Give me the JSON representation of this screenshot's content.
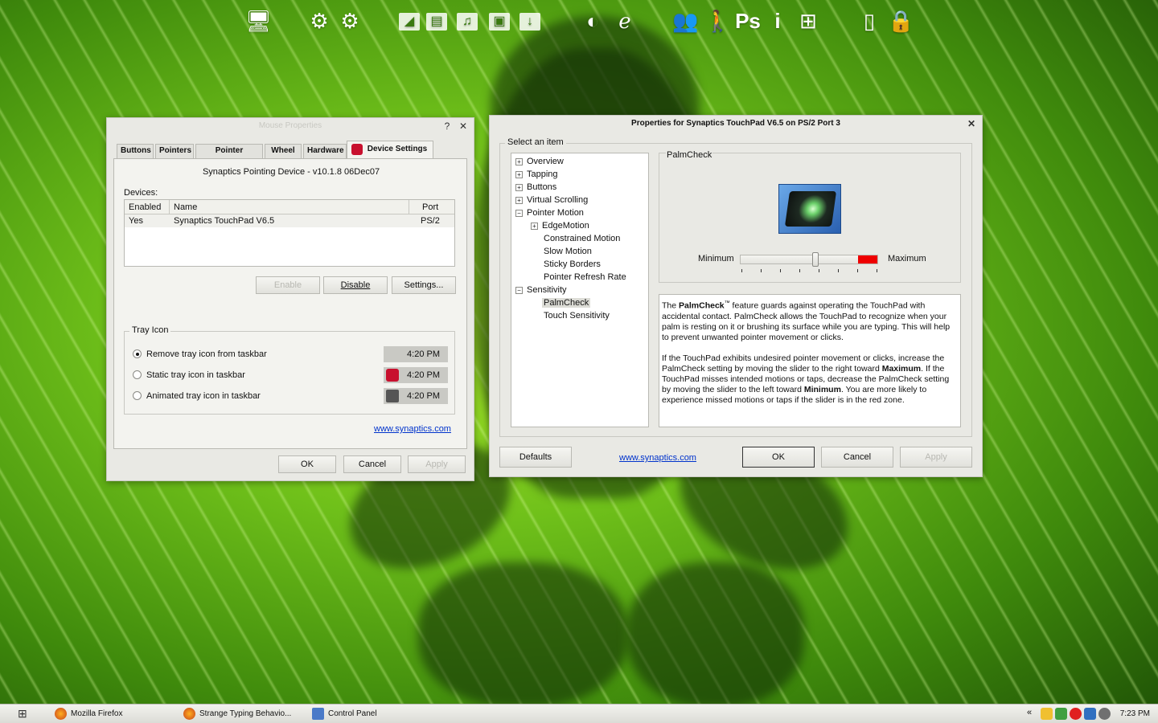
{
  "dock": {
    "icons": [
      "monitor-icon",
      "gear-icon",
      "gear-icon",
      "media-icon",
      "document-icon",
      "music-icon",
      "picture-icon",
      "download-icon",
      "firefox-icon",
      "internet-explorer-icon",
      "users-icon",
      "user-walk-icon",
      "photoshop-icon",
      "info-icon",
      "network-icon",
      "battery-icon",
      "lock-icon"
    ],
    "ps_label": "Ps",
    "info_label": "i"
  },
  "mouse_window": {
    "title": "Mouse Properties",
    "help": "?",
    "close": "✕",
    "tabs": [
      "Buttons",
      "Pointers",
      "Pointer Options",
      "Wheel",
      "Hardware",
      "Device Settings"
    ],
    "device_title": "Synaptics Pointing Device - v10.1.8 06Dec07",
    "devices_label": "Devices:",
    "columns": [
      "Enabled",
      "Name",
      "Port"
    ],
    "rows": [
      {
        "enabled": "Yes",
        "name": "Synaptics TouchPad V6.5",
        "port": "PS/2"
      }
    ],
    "enable_btn": "Enable",
    "disable_btn": "Disable",
    "settings_btn": "Settings...",
    "tray_group": "Tray Icon",
    "tray_options": [
      {
        "label": "Remove tray icon from taskbar",
        "time": "4:20 PM",
        "selected": true
      },
      {
        "label": "Static tray icon in taskbar",
        "time": "4:20 PM",
        "selected": false
      },
      {
        "label": "Animated tray icon in taskbar",
        "time": "4:20 PM",
        "selected": false
      }
    ],
    "link": "www.synaptics.com",
    "ok": "OK",
    "cancel": "Cancel",
    "apply": "Apply"
  },
  "synaptics_window": {
    "title": "Properties for Synaptics TouchPad V6.5 on PS/2 Port 3",
    "close": "✕",
    "select_label": "Select an item",
    "tree": [
      {
        "label": "Overview",
        "level": 0,
        "exp": "+"
      },
      {
        "label": "Tapping",
        "level": 0,
        "exp": "+"
      },
      {
        "label": "Buttons",
        "level": 0,
        "exp": "+"
      },
      {
        "label": "Virtual Scrolling",
        "level": 0,
        "exp": "+"
      },
      {
        "label": "Pointer Motion",
        "level": 0,
        "exp": "−"
      },
      {
        "label": "EdgeMotion",
        "level": 1,
        "exp": "+"
      },
      {
        "label": "Constrained Motion",
        "level": 1,
        "exp": ""
      },
      {
        "label": "Slow Motion",
        "level": 1,
        "exp": ""
      },
      {
        "label": "Sticky Borders",
        "level": 1,
        "exp": ""
      },
      {
        "label": "Pointer Refresh Rate",
        "level": 1,
        "exp": ""
      },
      {
        "label": "Sensitivity",
        "level": 0,
        "exp": "−"
      },
      {
        "label": "PalmCheck",
        "level": 1,
        "exp": "",
        "selected": true
      },
      {
        "label": "Touch Sensitivity",
        "level": 1,
        "exp": ""
      }
    ],
    "palm_group": "PalmCheck",
    "min_label": "Minimum",
    "max_label": "Maximum",
    "slider_value": 0.55,
    "desc": {
      "p1_a": "The ",
      "p1_b": "PalmCheck",
      "p1_tm": "™",
      "p1_c": " feature guards against operating the TouchPad with accidental contact.  PalmCheck allows the TouchPad to recognize when your palm is resting on it or brushing its surface while you are typing.  This will help to prevent unwanted pointer movement or clicks.",
      "p2_a": "If the TouchPad exhibits undesired pointer movement or clicks, increase the PalmCheck setting by moving the slider to the right toward ",
      "p2_b": "Maximum",
      "p2_c": ".  If the TouchPad misses intended motions or taps, decrease the PalmCheck setting by moving the slider to the left toward ",
      "p2_d": "Minimum",
      "p2_e": ".  You are more likely to experience missed motions or taps if the slider is in the red zone."
    },
    "defaults": "Defaults",
    "link": "www.synaptics.com",
    "ok": "OK",
    "cancel": "Cancel",
    "apply": "Apply"
  },
  "taskbar": {
    "tasks": [
      "Mozilla Firefox",
      "Strange Typing Behavio...",
      "Control Panel"
    ],
    "chevron": "«",
    "clock": "7:23 PM"
  },
  "colors": {
    "accent_red": "#ee0000",
    "link_blue": "#0033cc"
  }
}
